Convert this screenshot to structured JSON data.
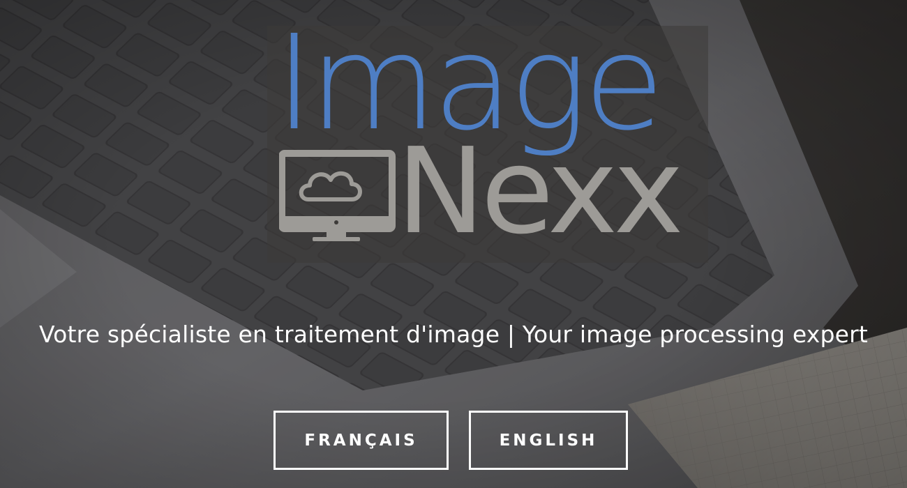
{
  "logo": {
    "word_top": "Image",
    "word_bottom": "Nexx",
    "icon": "monitor-cloud-icon",
    "colors": {
      "top_word": "#4e7ec4",
      "bottom_word": "#9d9b97",
      "icon": "#9d9b97"
    }
  },
  "tagline": "Votre spécialiste en traitement d'image | Your image processing expert",
  "buttons": {
    "french_label": "FRANÇAIS",
    "english_label": "ENGLISH"
  },
  "colors": {
    "overlay": "#3c3a38",
    "text": "#ffffff"
  }
}
